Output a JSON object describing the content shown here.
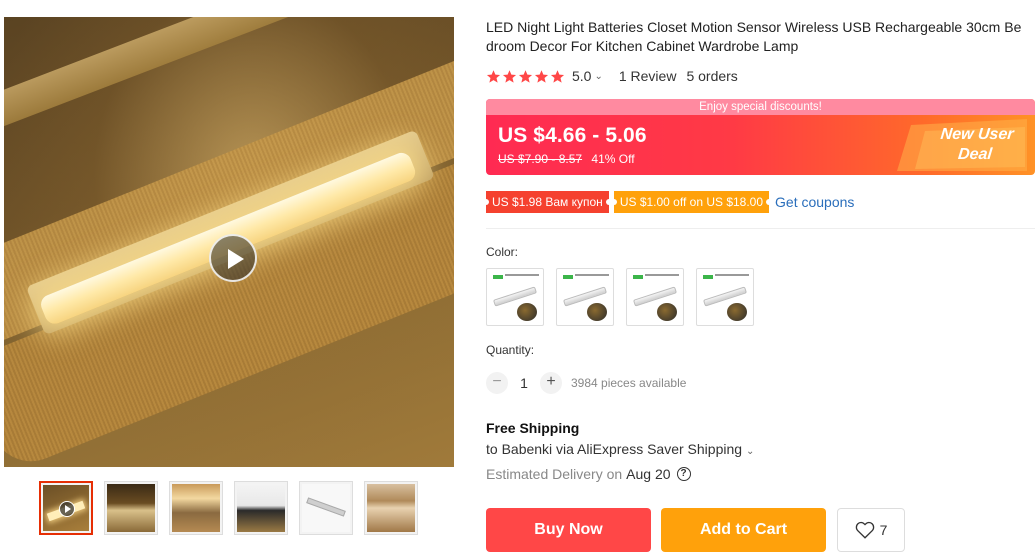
{
  "gallery": {
    "main_image": "led-light-bar-on-closet-shelf",
    "thumbnails": [
      {
        "name": "video-thumbnail",
        "has_play": true
      },
      {
        "name": "light-under-shelf"
      },
      {
        "name": "kitchen-cabinet-lights"
      },
      {
        "name": "lamp-package"
      },
      {
        "name": "light-bar-with-cable"
      },
      {
        "name": "wardrobe-shelves"
      }
    ]
  },
  "product": {
    "title": "LED Night Light Batteries Closet Motion Sensor Wireless USB Rechargeable 30cm Bedroom Decor For Kitchen Cabinet Wardrobe Lamp",
    "title_line1": "LED Night Light Batteries Closet Motion Sensor Wireless USB Rechargeable 30cm Be",
    "title_line2": "droom Decor For Kitchen Cabinet Wardrobe Lamp",
    "rating": {
      "value": "5.0",
      "stars": 5,
      "reviews": "1 Review",
      "orders": "5 orders"
    }
  },
  "promo": {
    "top_text": "Enjoy special discounts!",
    "price": "US $4.66 - 5.06",
    "old_price": "US $7.90 - 8.57",
    "discount": "41% Off",
    "badge_line1": "New User",
    "badge_line2": "Deal",
    "colors": {
      "start": "#ff2a52",
      "end": "#ff9226"
    }
  },
  "coupons": {
    "items": [
      {
        "text": "US $1.98 Вам купон",
        "color": "#f5412f"
      },
      {
        "text": "US $1.00 off on US $18.00",
        "color": "#ffa10b"
      }
    ],
    "link": "Get coupons"
  },
  "sku": {
    "color_label": "Color:",
    "swatches": [
      "swatch-1",
      "swatch-2",
      "swatch-3",
      "swatch-4"
    ]
  },
  "quantity": {
    "label": "Quantity:",
    "minus": "−",
    "value": "1",
    "plus": "+",
    "available": "3984 pieces available"
  },
  "shipping": {
    "title": "Free Shipping",
    "detail": "to Babenki via AliExpress Saver Shipping",
    "estimated_label": "Estimated Delivery on",
    "date": "Aug 20"
  },
  "actions": {
    "buy_now": "Buy Now",
    "add_to_cart": "Add to Cart",
    "wishlist_count": "7",
    "colors": {
      "buy": "#ff4747",
      "cart": "#ffa10b"
    }
  }
}
